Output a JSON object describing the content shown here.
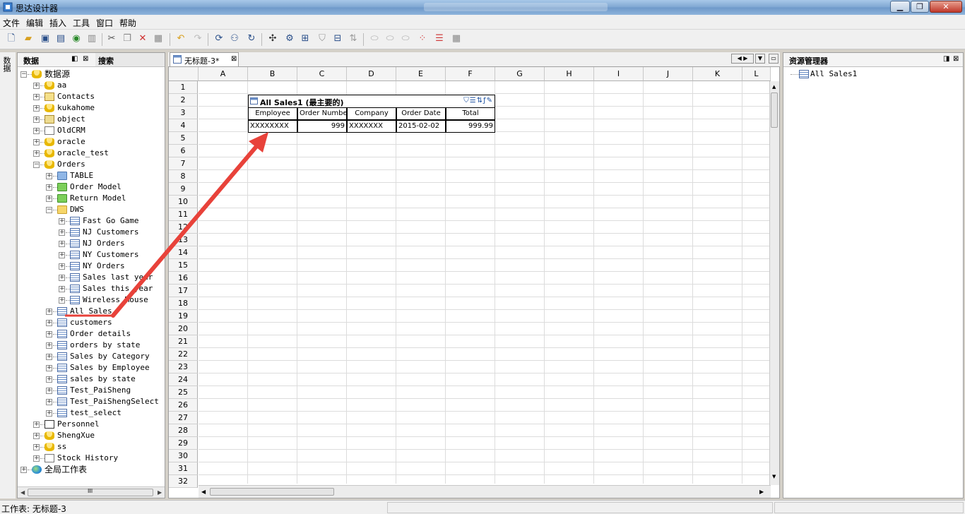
{
  "window": {
    "title": "思达设计器"
  },
  "menu": [
    "文件",
    "编辑",
    "插入",
    "工具",
    "窗口",
    "帮助"
  ],
  "left_tabs": {
    "vertical": "数据",
    "data_tab": "数据",
    "search_tab": "搜索"
  },
  "tree": [
    {
      "label": "数据源",
      "level": 0,
      "icon": "db",
      "expanded": true
    },
    {
      "label": "aa",
      "level": 1,
      "icon": "db"
    },
    {
      "label": "Contacts",
      "level": 1,
      "icon": "contact"
    },
    {
      "label": "kukahome",
      "level": 1,
      "icon": "db"
    },
    {
      "label": "object",
      "level": 1,
      "icon": "obj"
    },
    {
      "label": "OldCRM",
      "level": 1,
      "icon": "crm"
    },
    {
      "label": "oracle",
      "level": 1,
      "icon": "db"
    },
    {
      "label": "oracle_test",
      "level": 1,
      "icon": "db"
    },
    {
      "label": "Orders",
      "level": 1,
      "icon": "db",
      "expanded": true
    },
    {
      "label": "TABLE",
      "level": 2,
      "icon": "bfolder"
    },
    {
      "label": "Order Model",
      "level": 2,
      "icon": "gfolder"
    },
    {
      "label": "Return Model",
      "level": 2,
      "icon": "gfolder"
    },
    {
      "label": "DWS",
      "level": 2,
      "icon": "folder",
      "expanded": true
    },
    {
      "label": "Fast Go Game",
      "level": 3,
      "icon": "table"
    },
    {
      "label": "NJ Customers",
      "level": 3,
      "icon": "table"
    },
    {
      "label": "NJ Orders",
      "level": 3,
      "icon": "table"
    },
    {
      "label": "NY Customers",
      "level": 3,
      "icon": "table"
    },
    {
      "label": "NY Orders",
      "level": 3,
      "icon": "table"
    },
    {
      "label": "Sales last year",
      "level": 3,
      "icon": "table"
    },
    {
      "label": "Sales this year",
      "level": 3,
      "icon": "table"
    },
    {
      "label": "Wireless Mouse",
      "level": 3,
      "icon": "table"
    },
    {
      "label": "All Sales",
      "level": 2,
      "icon": "table"
    },
    {
      "label": "customers",
      "level": 2,
      "icon": "table"
    },
    {
      "label": "Order details",
      "level": 2,
      "icon": "table"
    },
    {
      "label": "orders by state",
      "level": 2,
      "icon": "table"
    },
    {
      "label": "Sales by Category",
      "level": 2,
      "icon": "table"
    },
    {
      "label": "Sales by Employee",
      "level": 2,
      "icon": "table"
    },
    {
      "label": "sales by state",
      "level": 2,
      "icon": "table"
    },
    {
      "label": "Test_PaiSheng",
      "level": 2,
      "icon": "table"
    },
    {
      "label": "Test_PaiShengSelect",
      "level": 2,
      "icon": "table"
    },
    {
      "label": "test_select",
      "level": 2,
      "icon": "table"
    },
    {
      "label": "Personnel",
      "level": 1,
      "icon": "xls"
    },
    {
      "label": "ShengXue",
      "level": 1,
      "icon": "db"
    },
    {
      "label": "ss",
      "level": 1,
      "icon": "db"
    },
    {
      "label": "Stock History",
      "level": 1,
      "icon": "crm"
    },
    {
      "label": "全局工作表",
      "level": 0,
      "icon": "globe"
    }
  ],
  "doc_tab": {
    "title": "无标题-3*",
    "close": "⊠"
  },
  "columns": [
    "A",
    "B",
    "C",
    "D",
    "E",
    "F",
    "G",
    "H",
    "I",
    "J",
    "K",
    "L"
  ],
  "rows": [
    "1",
    "2",
    "3",
    "4",
    "5",
    "6",
    "7",
    "8",
    "9",
    "10",
    "11",
    "12",
    "13",
    "14",
    "15",
    "16",
    "17",
    "18",
    "19",
    "20",
    "21",
    "22",
    "23",
    "24",
    "25",
    "26",
    "27",
    "28",
    "29",
    "30",
    "31",
    "32"
  ],
  "report": {
    "title": "All Sales1 (最主要的)",
    "headers": [
      "Employee",
      "Order Number",
      "Company",
      "Order Date",
      "Total"
    ],
    "row": [
      "XXXXXXXX",
      "999",
      "XXXXXXX",
      "2015-02-02",
      "999.99"
    ]
  },
  "resource_panel": {
    "title": "资源管理器",
    "item": "All Sales1"
  },
  "status": {
    "text": "工作表: 无标题-3"
  },
  "scroll_glyph": "III",
  "colors": {
    "accent": "#e8423a",
    "title_bar": "#7ea6d2"
  }
}
